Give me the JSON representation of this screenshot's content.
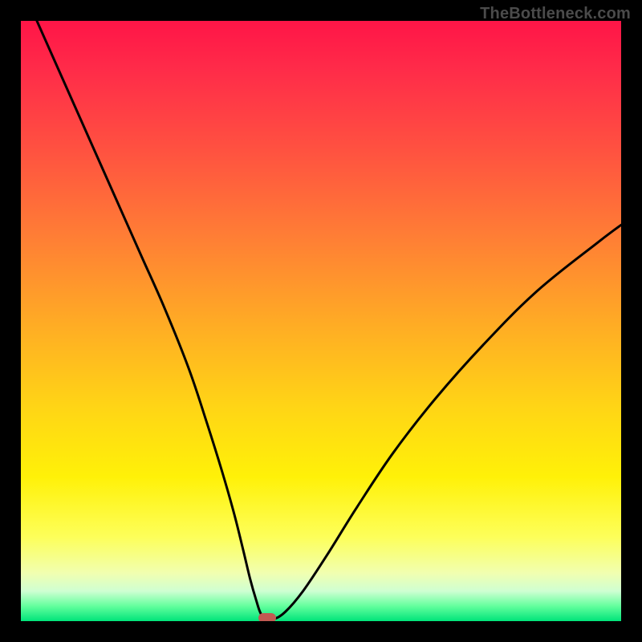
{
  "watermark": "TheBottleneck.com",
  "chart_data": {
    "type": "line",
    "title": "",
    "xlabel": "",
    "ylabel": "",
    "x_range": [
      0,
      100
    ],
    "y_range": [
      0,
      100
    ],
    "series": [
      {
        "name": "curve",
        "x": [
          0,
          4,
          8,
          12,
          16,
          20,
          24,
          28,
          31,
          33.5,
          35.5,
          37,
          38.2,
          39.2,
          40,
          41,
          42,
          44,
          47,
          51,
          56,
          62,
          69,
          77,
          86,
          96,
          100
        ],
        "y": [
          106,
          97,
          88,
          79,
          70,
          61,
          52,
          42,
          33,
          25,
          18,
          12,
          7,
          3.5,
          1.2,
          0.4,
          0.3,
          1.5,
          5,
          11,
          19,
          28,
          37,
          46,
          55,
          63,
          66
        ]
      }
    ],
    "marker": {
      "x": 41,
      "y": 0.6
    },
    "gradient": {
      "orientation": "vertical",
      "stops": [
        {
          "pct": 0,
          "color": "#ff1547"
        },
        {
          "pct": 8,
          "color": "#ff2b49"
        },
        {
          "pct": 22,
          "color": "#ff5340"
        },
        {
          "pct": 36,
          "color": "#ff7e35"
        },
        {
          "pct": 50,
          "color": "#ffaa25"
        },
        {
          "pct": 64,
          "color": "#ffd416"
        },
        {
          "pct": 76,
          "color": "#fff108"
        },
        {
          "pct": 86,
          "color": "#fdff5a"
        },
        {
          "pct": 92,
          "color": "#f1ffb0"
        },
        {
          "pct": 95,
          "color": "#cfffd2"
        },
        {
          "pct": 97.5,
          "color": "#63ff9d"
        },
        {
          "pct": 100,
          "color": "#00e47a"
        }
      ]
    }
  }
}
